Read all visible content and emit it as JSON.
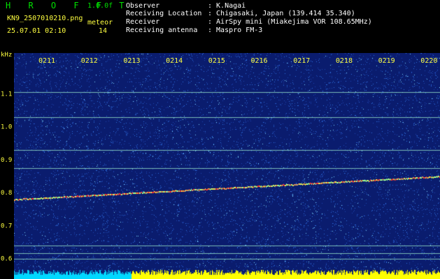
{
  "header": {
    "logo": "H R O F F T",
    "version": "1.0.0f",
    "filename": "KN9_2507010210.png",
    "timestamp": "25.07.01 02:10",
    "meteor_label": "meteor",
    "meteor_count": "14",
    "info_labels": [
      "Observer",
      "Receiving Location",
      "Receiver",
      "Receiving antenna"
    ],
    "info_values": [
      ": K.Nagai",
      ": Chigasaki, Japan (139.414 35.340)",
      ": AirSpy mini (Miakejima VOR 108.65MHz)",
      ": Maspro FM-3"
    ]
  },
  "chart_data": {
    "type": "heatmap",
    "y_unit_label": "kHz",
    "y_ticks": [
      "1.1",
      "1.0",
      "0.9",
      "0.8",
      "0.7",
      "0.6"
    ],
    "y_tick_values": [
      1.1,
      1.0,
      0.9,
      0.8,
      0.7,
      0.6
    ],
    "ylim": [
      0.58,
      1.19
    ],
    "x_ticks": [
      "0211",
      "0212",
      "0213",
      "0214",
      "0215",
      "0216",
      "0217",
      "0218",
      "0219",
      "0220"
    ],
    "xlim_minutes": [
      0,
      10
    ],
    "horizontal_lines_khz": [
      1.105,
      1.03,
      0.93,
      0.875,
      0.64,
      0.615,
      0.6
    ],
    "drifting_trace_khz": {
      "start": 0.78,
      "end": 0.85
    },
    "background_color": "#0a1c6e",
    "noise_color": "#2e6fe0",
    "line_color": "#9ff0d0",
    "trace_color": "#ff3030",
    "bottom_band_colors": [
      "#00d8ff",
      "#ffff00"
    ]
  }
}
